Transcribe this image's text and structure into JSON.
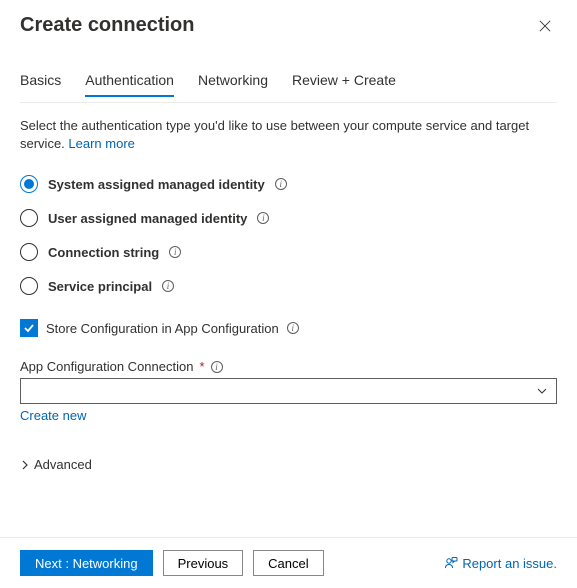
{
  "header": {
    "title": "Create connection"
  },
  "tabs": [
    {
      "label": "Basics"
    },
    {
      "label": "Authentication"
    },
    {
      "label": "Networking"
    },
    {
      "label": "Review + Create"
    }
  ],
  "active_tab_index": 1,
  "description": {
    "text": "Select the authentication type you'd like to use between your compute service and target service. ",
    "link": "Learn more"
  },
  "auth_options": [
    {
      "label": "System assigned managed identity",
      "selected": true
    },
    {
      "label": "User assigned managed identity",
      "selected": false
    },
    {
      "label": "Connection string",
      "selected": false
    },
    {
      "label": "Service principal",
      "selected": false
    }
  ],
  "store_config": {
    "label": "Store Configuration in App Configuration",
    "checked": true
  },
  "app_config_field": {
    "label": "App Configuration Connection",
    "required_marker": "*",
    "value": "",
    "create_new": "Create new"
  },
  "advanced_label": "Advanced",
  "footer": {
    "next": "Next : Networking",
    "previous": "Previous",
    "cancel": "Cancel",
    "report": "Report an issue."
  }
}
